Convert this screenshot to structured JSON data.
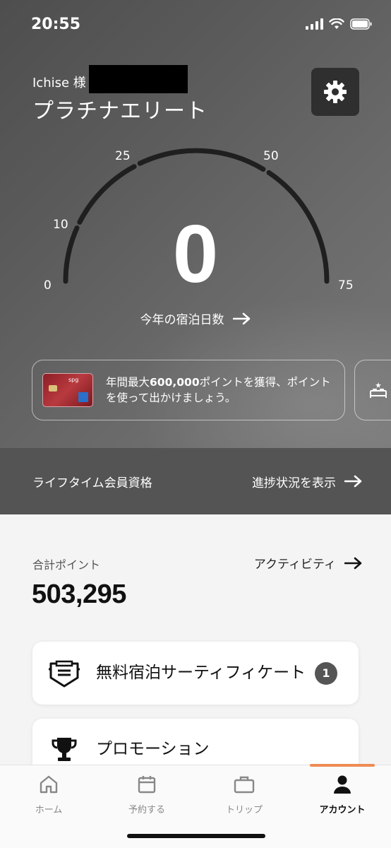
{
  "status_bar": {
    "time": "20:55"
  },
  "header": {
    "greeting": "Ichise 様",
    "tier": "プラチナエリート"
  },
  "gauge": {
    "labels": {
      "l0": "0",
      "l10": "10",
      "l25": "25",
      "l50": "50",
      "l75": "75"
    },
    "nights_value": "0",
    "nights_label": "今年の宿泊日数"
  },
  "promo": {
    "card_brand": "spg",
    "text_prefix": "年間最大",
    "text_bold": "600,000",
    "text_suffix": "ポイントを獲得、ポイントを使って出かけましょう。"
  },
  "lifetime": {
    "label": "ライフタイム会員資格",
    "link": "進捗状況を表示"
  },
  "points": {
    "label": "合計ポイント",
    "value": "503,295",
    "activity_link": "アクティビティ"
  },
  "list": {
    "free_night": {
      "label": "無料宿泊サーティフィケート",
      "count": "1"
    },
    "promotion": {
      "label": "プロモーション"
    }
  },
  "tabbar": {
    "home": "ホーム",
    "reserve": "予約する",
    "trip": "トリップ",
    "account": "アカウント",
    "active": "account"
  }
}
